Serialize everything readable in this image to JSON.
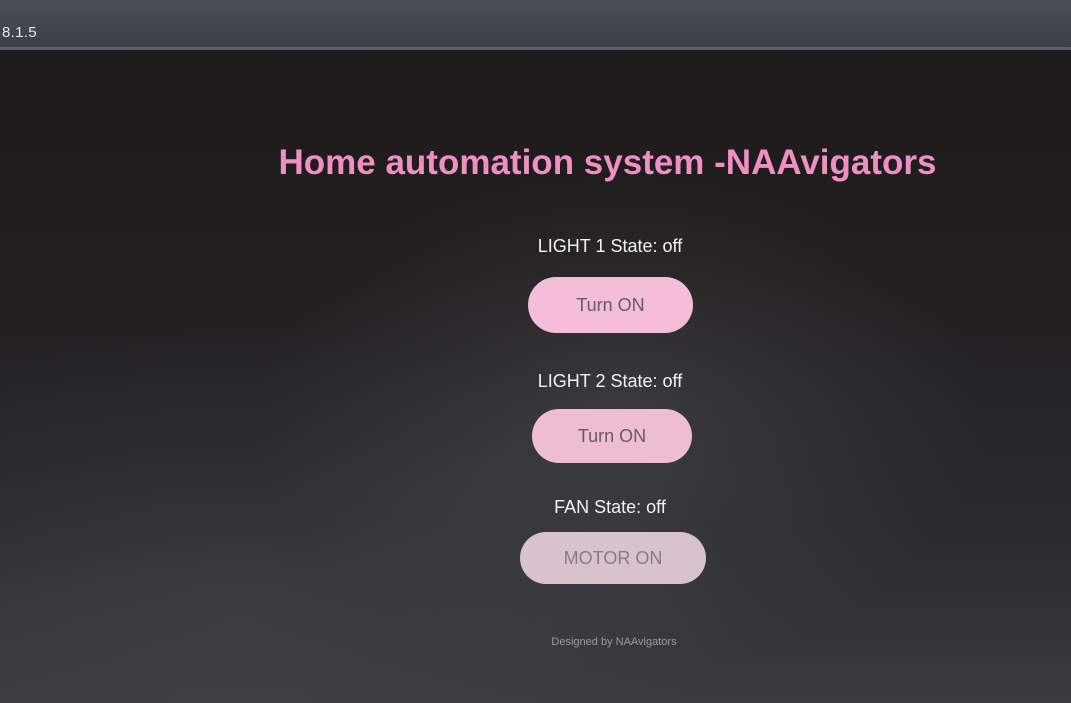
{
  "browser": {
    "address_text": "8.1.5"
  },
  "page": {
    "title": "Home automation system -NAAvigators",
    "devices": [
      {
        "state_label": "LIGHT 1 State: off",
        "button_label": "Turn ON"
      },
      {
        "state_label": "LIGHT 2 State: off",
        "button_label": "Turn ON"
      },
      {
        "state_label": "FAN State: off",
        "button_label": "MOTOR ON"
      }
    ],
    "footer": "Designed by NAAvigators"
  },
  "colors": {
    "title": "#ef8fc4",
    "button_bg": "#f4bdd9",
    "background": "#1c1c1e"
  }
}
